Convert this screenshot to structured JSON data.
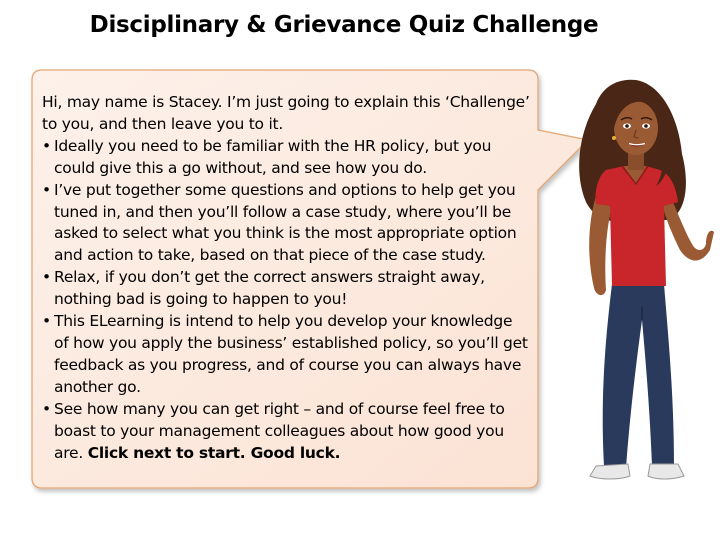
{
  "slide": {
    "title": "Disciplinary & Grievance Quiz Challenge"
  },
  "speech_bubble": {
    "intro": "Hi, may name is Stacey. I’m just going to explain this ‘Challenge’ to you, and then leave you to it.",
    "bullets": [
      "Ideally you need to be familiar with the HR policy, but you could give this a go without, and see how you do.",
      "I’ve put together some questions and options to help get you tuned in, and then you’ll follow a case study, where you’ll be asked to select what you think is the most appropriate option and action to take, based on that piece of the case study.",
      "Relax, if you don’t get the correct answers straight away, nothing bad is going to happen to you!",
      "This ELearning is intend to help you develop your knowledge of how you apply the business’ established policy, so you’ll get feedback as you progress, and of course you can always have another go.",
      "See how many you can get right – and of course feel free to boast to your management colleagues about how good you are."
    ],
    "call_to_action": "Click next to start. Good luck.",
    "bullet_glyph": "•"
  },
  "colors": {
    "bubble_fill": "#fce8dc",
    "bubble_border": "#e3a774",
    "shirt": "#c8262a",
    "jeans": "#2a3a5c",
    "skin": "#9a5a34",
    "hair": "#4a2616"
  },
  "icons": {
    "character": "stacey-character-illustration"
  }
}
